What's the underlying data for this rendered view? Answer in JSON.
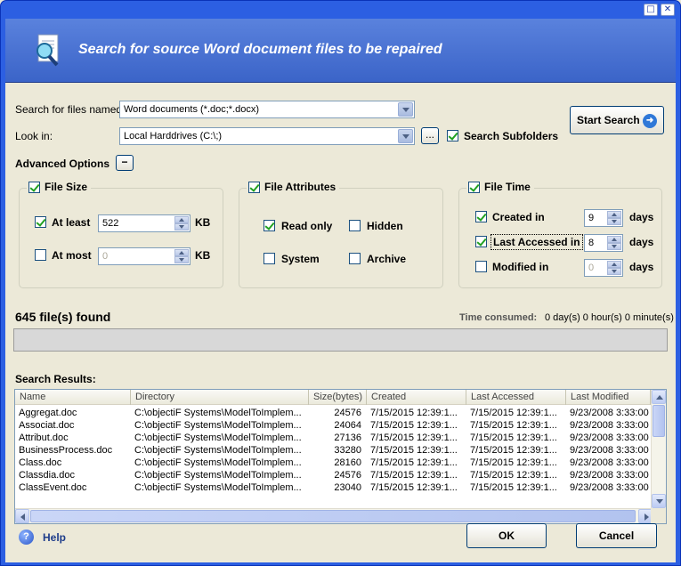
{
  "window": {
    "controls": [
      "□",
      "✕"
    ]
  },
  "banner": {
    "title": "Search for source Word document files to be repaired",
    "icon": "document-search-icon"
  },
  "search": {
    "files_named_label": "Search for files named:",
    "files_named_value": "Word documents (*.doc;*.docx)",
    "look_in_label": "Look in:",
    "look_in_value": "Local Harddrives (C:\\;)",
    "browse_label": "...",
    "subfolders_label": "Search Subfolders",
    "subfolders_checked": true,
    "start_label": "Start Search"
  },
  "advanced": {
    "label": "Advanced Options",
    "toggle": "−"
  },
  "file_size": {
    "title": "File Size",
    "checked": true,
    "at_least_label": "At least",
    "at_least_checked": true,
    "at_least_value": "522",
    "at_least_unit": "KB",
    "at_most_label": "At most",
    "at_most_checked": false,
    "at_most_value": "0",
    "at_most_unit": "KB"
  },
  "file_attributes": {
    "title": "File Attributes",
    "checked": true,
    "read_only": "Read only",
    "read_only_checked": true,
    "hidden": "Hidden",
    "hidden_checked": false,
    "system": "System",
    "system_checked": false,
    "archive": "Archive",
    "archive_checked": false
  },
  "file_time": {
    "title": "File Time",
    "checked": true,
    "created_label": "Created in",
    "created_checked": true,
    "created_value": "9",
    "created_unit": "days",
    "accessed_label": "Last Accessed in",
    "accessed_checked": true,
    "accessed_value": "8",
    "accessed_unit": "days",
    "modified_label": "Modified in",
    "modified_checked": false,
    "modified_value": "0",
    "modified_unit": "days"
  },
  "status": {
    "found": "645 file(s) found",
    "time_label": "Time consumed:",
    "time_value": "0 day(s) 0 hour(s) 0 minute(s)"
  },
  "results": {
    "label": "Search Results:",
    "columns": [
      "Name",
      "Directory",
      "Size(bytes)",
      "Created",
      "Last Accessed",
      "Last Modified"
    ],
    "rows": [
      [
        "Aggregat.doc",
        "C:\\objectiF Systems\\ModelToImplem...",
        "24576",
        "7/15/2015 12:39:1...",
        "7/15/2015 12:39:1...",
        "9/23/2008 3:33:00"
      ],
      [
        "Associat.doc",
        "C:\\objectiF Systems\\ModelToImplem...",
        "24064",
        "7/15/2015 12:39:1...",
        "7/15/2015 12:39:1...",
        "9/23/2008 3:33:00"
      ],
      [
        "Attribut.doc",
        "C:\\objectiF Systems\\ModelToImplem...",
        "27136",
        "7/15/2015 12:39:1...",
        "7/15/2015 12:39:1...",
        "9/23/2008 3:33:00"
      ],
      [
        "BusinessProcess.doc",
        "C:\\objectiF Systems\\ModelToImplem...",
        "33280",
        "7/15/2015 12:39:1...",
        "7/15/2015 12:39:1...",
        "9/23/2008 3:33:00"
      ],
      [
        "Class.doc",
        "C:\\objectiF Systems\\ModelToImplem...",
        "28160",
        "7/15/2015 12:39:1...",
        "7/15/2015 12:39:1...",
        "9/23/2008 3:33:00"
      ],
      [
        "Classdia.doc",
        "C:\\objectiF Systems\\ModelToImplem...",
        "24576",
        "7/15/2015 12:39:1...",
        "7/15/2015 12:39:1...",
        "9/23/2008 3:33:00"
      ],
      [
        "ClassEvent.doc",
        "C:\\objectiF Systems\\ModelToImplem...",
        "23040",
        "7/15/2015 12:39:1...",
        "7/15/2015 12:39:1...",
        "9/23/2008 3:33:00"
      ]
    ]
  },
  "footer": {
    "help": "Help",
    "ok": "OK",
    "cancel": "Cancel"
  }
}
